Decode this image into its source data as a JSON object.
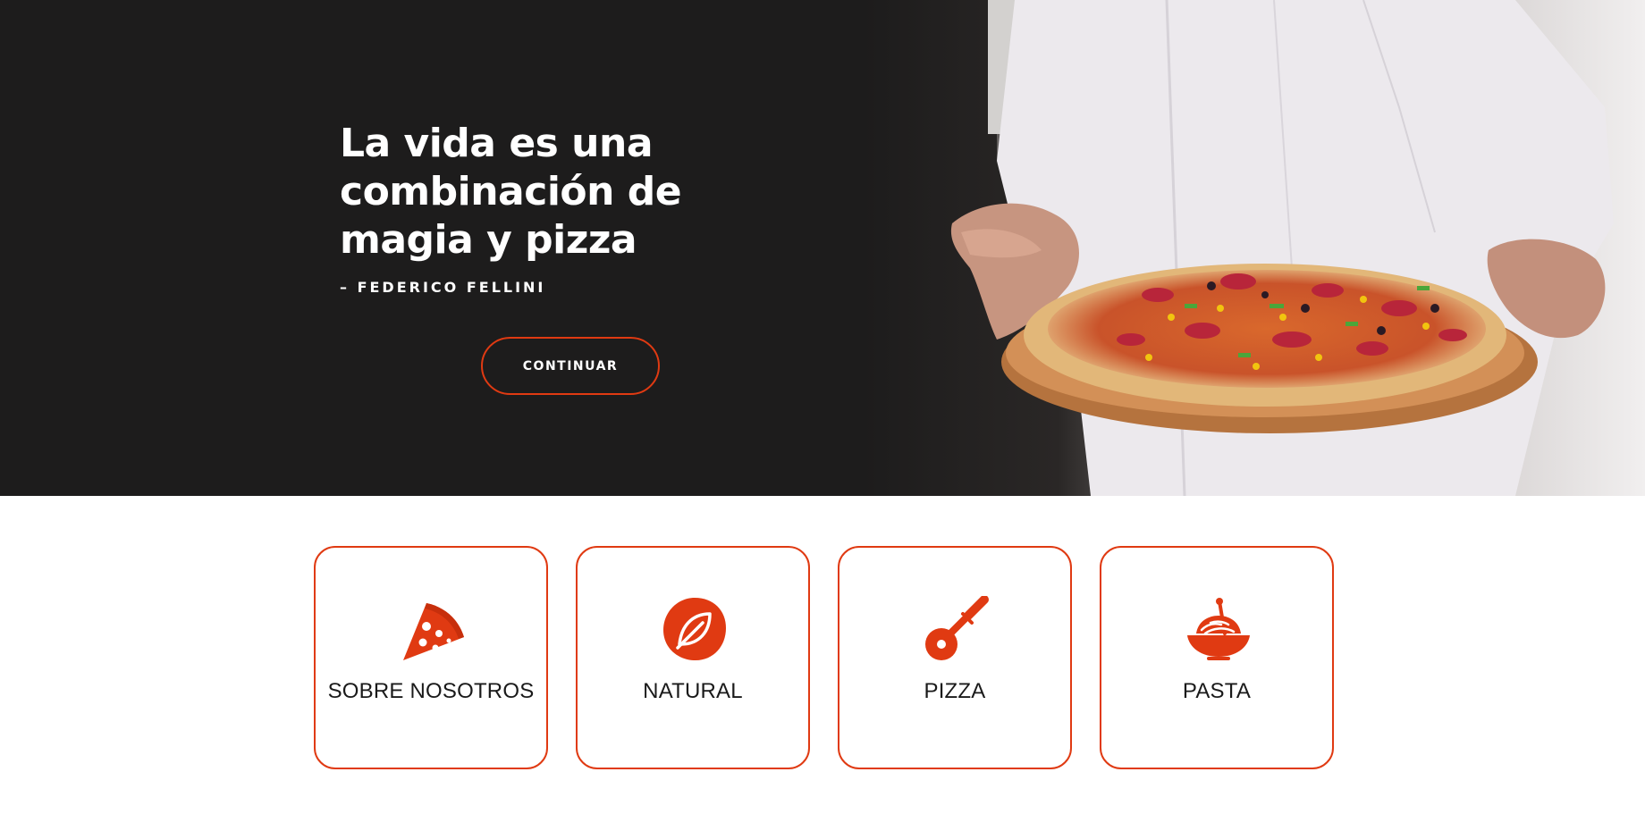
{
  "hero": {
    "quote": "La vida es una combinación de magia y pizza",
    "author": "– FEDERICO FELLINI",
    "button_label": "CONTINUAR"
  },
  "colors": {
    "accent": "#e03a12",
    "hero_background": "#1d1c1c",
    "text_dark": "#1a1a1a"
  },
  "cards": [
    {
      "label": "SOBRE NOSOTROS",
      "icon": "pizza-slice-icon"
    },
    {
      "label": "NATURAL",
      "icon": "leaf-icon"
    },
    {
      "label": "PIZZA",
      "icon": "pizza-cutter-icon"
    },
    {
      "label": "PASTA",
      "icon": "pasta-bowl-icon"
    }
  ]
}
